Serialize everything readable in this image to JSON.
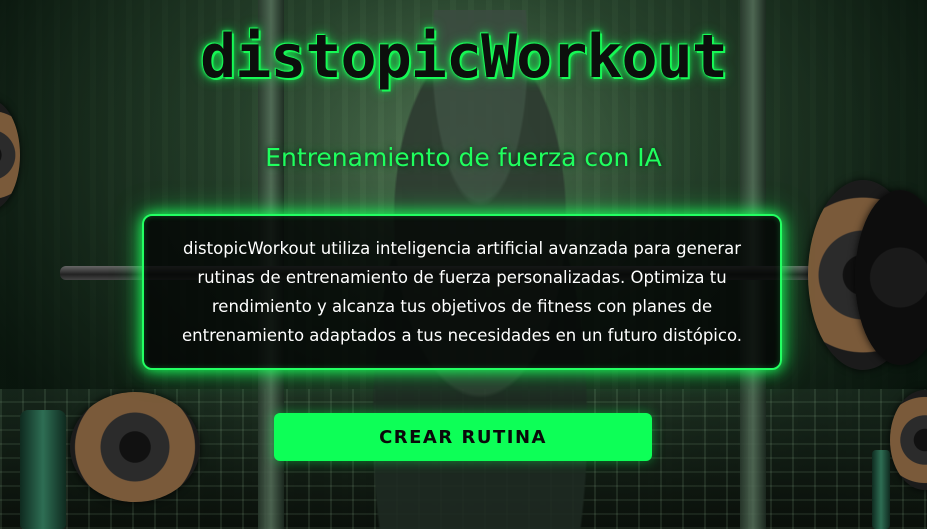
{
  "header": {
    "title": "distopicWorkout",
    "subtitle": "Entrenamiento de fuerza con IA"
  },
  "card": {
    "description": "distopicWorkout utiliza inteligencia artificial avanzada para generar rutinas de entrenamiento de fuerza personalizadas. Optimiza tu rendimiento y alcanza tus objetivos de fitness con planes de entrenamiento adaptados a tus necesidades en un futuro distópico."
  },
  "cta": {
    "label": "CREAR RUTINA"
  },
  "colors": {
    "accent": "#1aff5a",
    "button": "#0dff57",
    "card_bg": "#040605"
  }
}
